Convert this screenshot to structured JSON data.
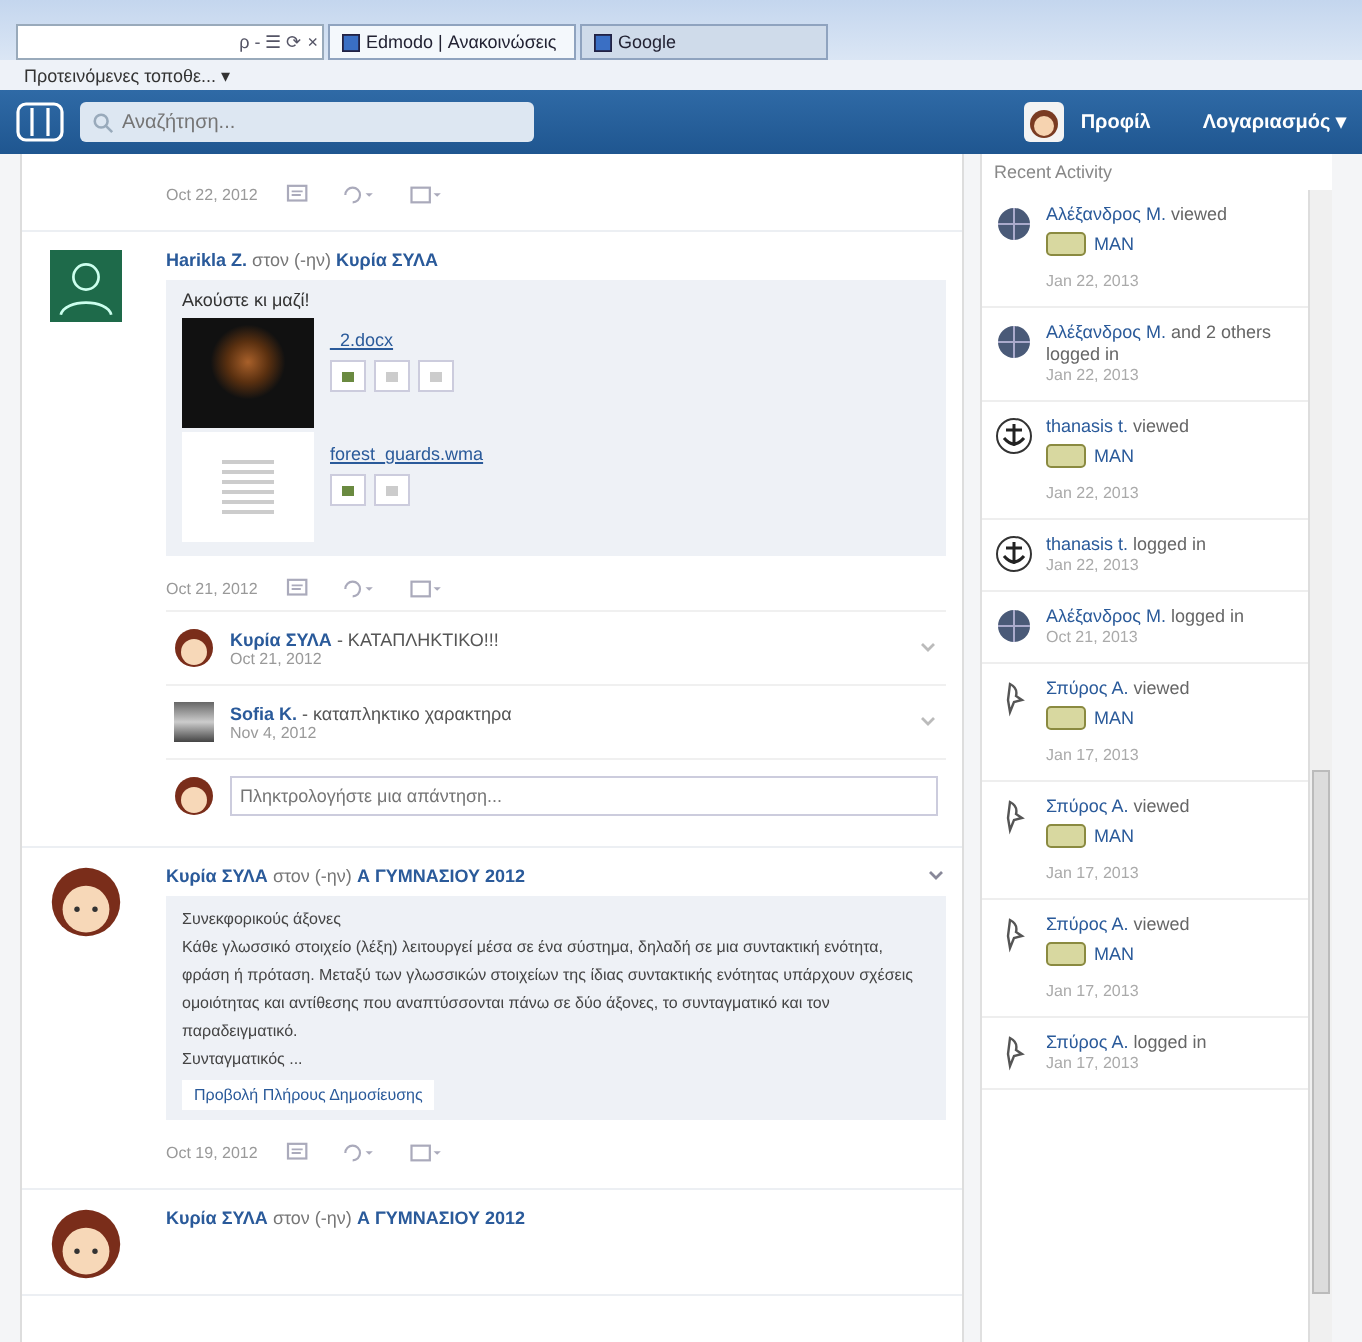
{
  "browser": {
    "address_controls": "ρ - ☰ ⟳ ×",
    "tabs": [
      {
        "label": "Edmodo | Ανακοινώσεις",
        "selected": true
      },
      {
        "label": "Google",
        "selected": false
      }
    ],
    "favorites": "Προτεινόμενες τοποθε... ▾"
  },
  "topbar": {
    "search_placeholder": "Αναζήτηση...",
    "profile": "Προφίλ",
    "account": "Λογαριασμός ▾"
  },
  "posts": [
    {
      "kind": "none",
      "date": "Oct 22, 2012"
    },
    {
      "kind": "silhouette",
      "author": "Harikla Z.",
      "connector": "στον (-ην)",
      "target": "Κυρία ΣΥΛΑ",
      "text": "Ακούστε κι μαζί!",
      "files": [
        {
          "name": "_2.docx",
          "kind": "photo"
        },
        {
          "name": "forest_guards.wma",
          "kind": "doc"
        }
      ],
      "date": "Oct 21, 2012",
      "replies": [
        {
          "kind": "girl",
          "author": "Κυρία ΣΥΛΑ",
          "text": "- ΚΑΤΑΠΛΗΚΤΙΚΟ!!!",
          "date": "Oct 21, 2012"
        },
        {
          "kind": "photo",
          "author": "Sofia K.",
          "text": "- καταπληκτικο χαρακτηρα",
          "date": "Nov 4, 2012"
        }
      ],
      "reply_placeholder": "Πληκτρολογήστε μια απάντηση..."
    },
    {
      "kind": "girl",
      "author": "Κυρία ΣΥΛΑ",
      "connector": "στον (-ην)",
      "target": "Α ΓΥΜΝΑΣΙΟΥ 2012",
      "paragraphs": [
        "Συνεκφορικούς άξονες",
        "Κάθε γλωσσικό στοιχείο (λέξη) λειτουργεί μέσα σε ένα σύστημα, δηλαδή σε μια συντακτική ενότητα, φράση ή πρόταση. Μεταξύ των γλωσσικών στοιχείων της ίδιας συντακτικής ενότητας υπάρχουν σχέσεις ομοιότητας και αντίθεσης που αναπτύσσονται πάνω σε δύο άξονες, το συνταγματικό και τον παραδειγματικό.",
        "Συνταγματικός ..."
      ],
      "link": "Προβολή Πλήρους Δημοσίευσης",
      "date": "Oct 19, 2012"
    },
    {
      "kind": "girl",
      "author": "Κυρία ΣΥΛΑ",
      "connector": "στον (-ην)",
      "target": "Α ΓΥΜΝΑΣΙΟΥ 2012"
    }
  ],
  "recent_activity": {
    "title": "Recent Activity",
    "items": [
      {
        "kind": "globe",
        "actor": "Αλέξανδρος Μ.",
        "action": "viewed",
        "badge": "MAN",
        "date": "Jan 22, 2013"
      },
      {
        "kind": "globe",
        "actor": "Αλέξανδρος Μ.",
        "action": "and 2 others logged in",
        "date": "Jan 22, 2013"
      },
      {
        "kind": "anchor",
        "actor": "thanasis t.",
        "action": "viewed",
        "badge": "MAN",
        "date": "Jan 22, 2013"
      },
      {
        "kind": "anchor",
        "actor": "thanasis t.",
        "action": "logged in",
        "date": "Jan 22, 2013"
      },
      {
        "kind": "globe",
        "actor": "Αλέξανδρος Μ.",
        "action": "logged in",
        "date": "Oct 21, 2013"
      },
      {
        "kind": "bird",
        "actor": "Σπύρος Α.",
        "action": "viewed",
        "badge": "MAN",
        "date": "Jan 17, 2013"
      },
      {
        "kind": "bird",
        "actor": "Σπύρος Α.",
        "action": "viewed",
        "badge": "MAN",
        "date": "Jan 17, 2013"
      },
      {
        "kind": "bird",
        "actor": "Σπύρος Α.",
        "action": "viewed",
        "badge": "MAN",
        "date": "Jan 17, 2013"
      },
      {
        "kind": "bird",
        "actor": "Σπύρος Α.",
        "action": "logged in",
        "date": "Jan 17, 2013"
      }
    ]
  }
}
